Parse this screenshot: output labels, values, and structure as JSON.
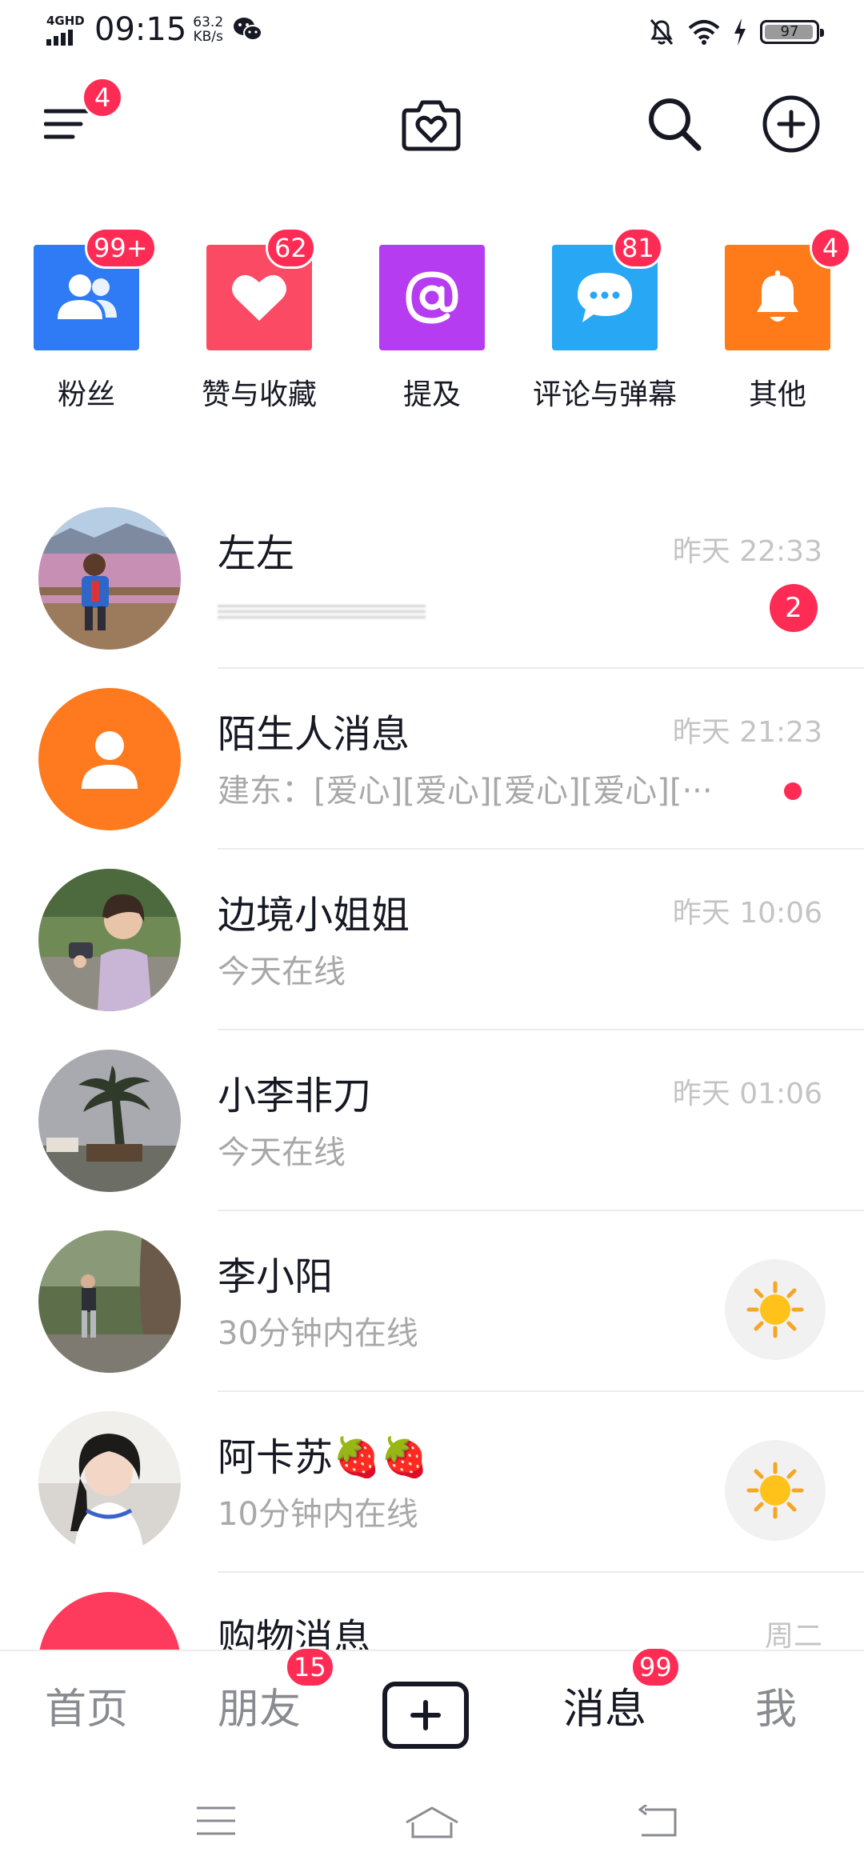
{
  "status_bar": {
    "network": "4GHD",
    "time": "09:15",
    "speed_value": "63.2",
    "speed_unit": "KB/s",
    "battery": "97",
    "battery_level": 0.97
  },
  "top_bar": {
    "menu_badge": "4"
  },
  "categories": [
    {
      "label": "粉丝",
      "badge": "99+",
      "color": "#2f7bf5"
    },
    {
      "label": "赞与收藏",
      "badge": "62",
      "color": "#fb4a64"
    },
    {
      "label": "提及",
      "badge": "",
      "color": "#b53cf0"
    },
    {
      "label": "评论与弹幕",
      "badge": "81",
      "color": "#28a7f4"
    },
    {
      "label": "其他",
      "badge": "4",
      "color": "#ff7a18"
    }
  ],
  "conversations": [
    {
      "name": "左左",
      "subtitle": "",
      "time": "昨天 22:33",
      "unread": "2"
    },
    {
      "name": "陌生人消息",
      "subtitle": "建东：[爱心][爱心][爱心][爱心][···",
      "time": "昨天 21:23"
    },
    {
      "name": "边境小姐姐",
      "subtitle": "今天在线",
      "time": "昨天 10:06"
    },
    {
      "name": "小李非刀",
      "subtitle": "今天在线",
      "time": "昨天 01:06"
    },
    {
      "name": "李小阳",
      "subtitle": "30分钟内在线",
      "time": ""
    },
    {
      "name": "阿卡苏🍓🍓",
      "subtitle": "10分钟内在线",
      "time": ""
    },
    {
      "name": "购物消息",
      "subtitle": "",
      "time": "周二"
    }
  ],
  "bottom_nav": {
    "home": "首页",
    "friends": "朋友",
    "friends_badge": "15",
    "messages": "消息",
    "messages_badge": "99",
    "me": "我"
  }
}
